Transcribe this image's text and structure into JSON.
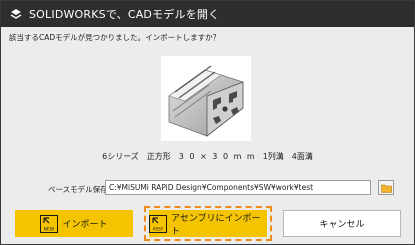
{
  "window": {
    "title": "SOLIDWORKSで、CADモデルを開く"
  },
  "message": "該当するCADモデルが見つかりました。インポートしますか？",
  "model": {
    "description": "6シリーズ　正方形　3 0 × 3 0 m m　1列溝　4面溝"
  },
  "path": {
    "label": "ベースモデル保存場所",
    "value": "C:¥MiSUMi RAPiD Design¥Components¥SW¥work¥test"
  },
  "buttons": {
    "import": "インポート",
    "import_icon_text": "NEW",
    "assembly_import": "アセンブリにインポート",
    "assembly_icon_text": "ASSY",
    "cancel": "キャンセル"
  },
  "colors": {
    "titlebar": "#2e2e2e",
    "accent_button": "#f5c400",
    "highlight_border": "#f08a1a"
  },
  "icons": [
    "solidworks-logo-icon",
    "folder-icon",
    "new-import-icon",
    "assembly-import-icon"
  ]
}
